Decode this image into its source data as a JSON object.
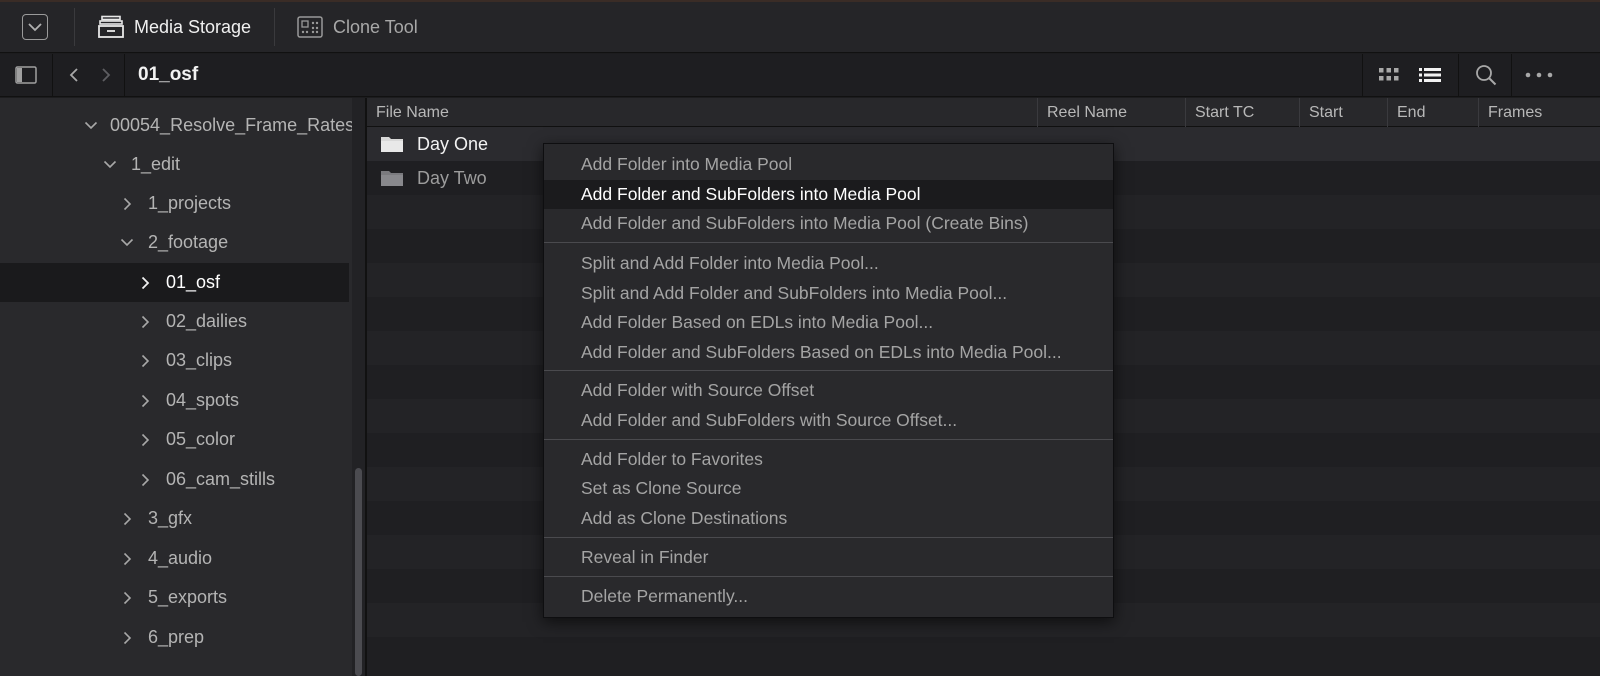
{
  "topbar": {
    "tabs": [
      {
        "label": "Media Storage",
        "active": true,
        "icon": "media-storage-icon"
      },
      {
        "label": "Clone Tool",
        "active": false,
        "icon": "clone-tool-icon"
      }
    ]
  },
  "navbar": {
    "current_folder": "01_osf",
    "view_modes": [
      "grid-view-icon",
      "list-view-icon"
    ],
    "selected_view": "list"
  },
  "sidebar": {
    "items": [
      {
        "label": "00054_Resolve_Frame_Rates",
        "expanded": true,
        "depth": 0
      },
      {
        "label": "1_edit",
        "expanded": true,
        "depth": 1
      },
      {
        "label": "1_projects",
        "expanded": false,
        "depth": 2
      },
      {
        "label": "2_footage",
        "expanded": true,
        "depth": 2
      },
      {
        "label": "01_osf",
        "expanded": false,
        "depth": 3,
        "selected": true
      },
      {
        "label": "02_dailies",
        "expanded": false,
        "depth": 3
      },
      {
        "label": "03_clips",
        "expanded": false,
        "depth": 3
      },
      {
        "label": "04_spots",
        "expanded": false,
        "depth": 3
      },
      {
        "label": "05_color",
        "expanded": false,
        "depth": 3
      },
      {
        "label": "06_cam_stills",
        "expanded": false,
        "depth": 3
      },
      {
        "label": "3_gfx",
        "expanded": false,
        "depth": 2
      },
      {
        "label": "4_audio",
        "expanded": false,
        "depth": 2
      },
      {
        "label": "5_exports",
        "expanded": false,
        "depth": 2
      },
      {
        "label": "6_prep",
        "expanded": false,
        "depth": 2
      }
    ]
  },
  "filelist": {
    "columns": [
      "File Name",
      "Reel Name",
      "Start TC",
      "Start",
      "End",
      "Frames"
    ],
    "rows": [
      {
        "name": "Day One",
        "selected": true
      },
      {
        "name": "Day Two",
        "selected": false
      }
    ]
  },
  "context_menu": {
    "groups": [
      [
        {
          "label": "Add Folder into Media Pool"
        },
        {
          "label": "Add Folder and SubFolders into Media Pool",
          "highlighted": true
        },
        {
          "label": "Add Folder and SubFolders into Media Pool (Create Bins)"
        }
      ],
      [
        {
          "label": "Split and Add Folder into Media Pool..."
        },
        {
          "label": "Split and Add Folder and SubFolders into Media Pool..."
        },
        {
          "label": "Add Folder Based on EDLs into Media Pool..."
        },
        {
          "label": "Add Folder and SubFolders Based on EDLs into Media Pool..."
        }
      ],
      [
        {
          "label": "Add Folder with Source Offset"
        },
        {
          "label": "Add Folder and SubFolders with Source Offset..."
        }
      ],
      [
        {
          "label": "Add Folder to Favorites"
        },
        {
          "label": "Set as Clone Source"
        },
        {
          "label": "Add as Clone Destinations"
        }
      ],
      [
        {
          "label": "Reveal in Finder"
        }
      ],
      [
        {
          "label": "Delete Permanently..."
        }
      ]
    ]
  },
  "colors": {
    "background": "#1c1c1e",
    "panel": "#29292c",
    "text": "#c8c8c8",
    "text_bright": "#ffffff",
    "highlight": "#1b1b1d"
  }
}
